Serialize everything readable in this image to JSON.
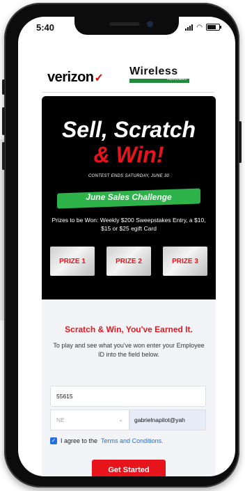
{
  "status_bar": {
    "time": "5:40"
  },
  "header": {
    "verizon_logo": "verizon",
    "partner_logo_title": "Wireless",
    "partner_logo_subtitle": "Advocates"
  },
  "hero": {
    "title_line1": "Sell, Scratch",
    "title_line2": "& Win!",
    "contest_notice": "CONTEST ENDS SATURDAY, JUNE 30",
    "banner": "June Sales Challenge",
    "prizes_text": "Prizes to be Won: Weekly $200 Sweepstakes Entry, a $10, $15 or $25 egift Card",
    "prizes": [
      {
        "label": "PRIZE 1"
      },
      {
        "label": "PRIZE 2"
      },
      {
        "label": "PRIZE 3"
      }
    ]
  },
  "form": {
    "heading": "Scratch & Win, You've Earned It.",
    "instructions": "To play and see what you've won enter your Employee ID into the field below.",
    "employee_id_value": "55615",
    "region_value": "NE",
    "email_value": "gabrielnapilot@yah",
    "agree_prefix": "I agree to the",
    "agree_link": "Terms and Conditions.",
    "submit_label": "Get Started"
  },
  "colors": {
    "accent_red": "#e8141c",
    "banner_green": "#2eb34a",
    "link_blue": "#1f6fe0"
  }
}
